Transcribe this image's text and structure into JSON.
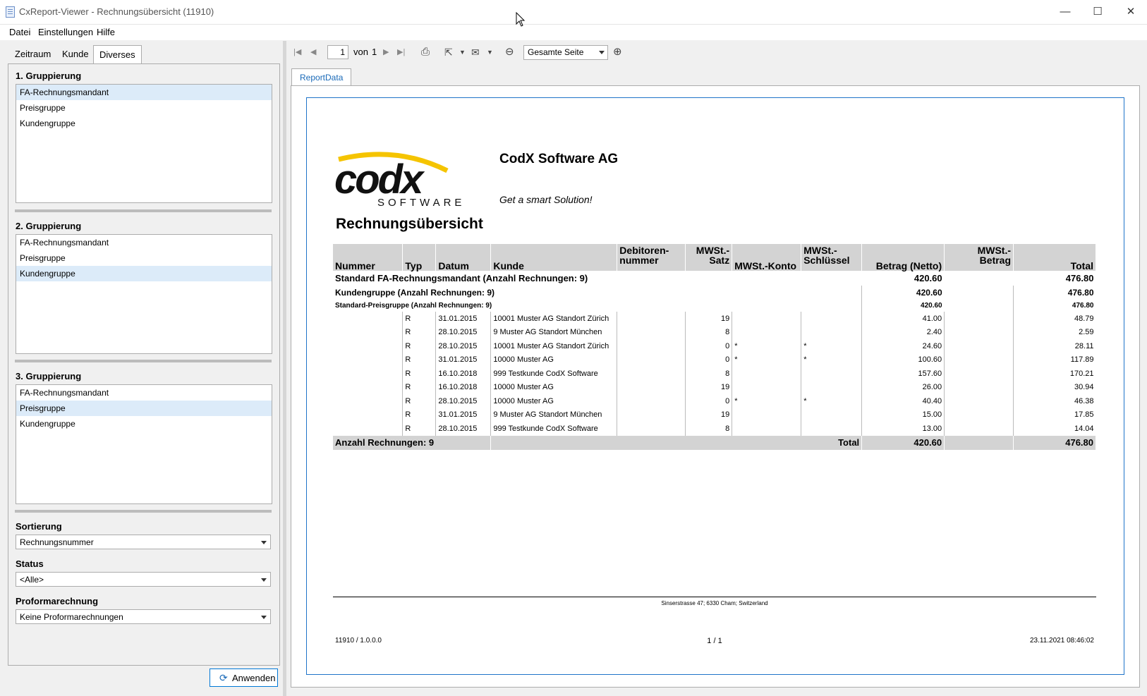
{
  "window": {
    "title": "CxReport-Viewer - Rechnungsübersicht (11910)",
    "minimize": "—",
    "maximize": "☐",
    "close": "✕"
  },
  "menu": {
    "datei": "Datei",
    "einstellungen": "Einstellungen",
    "hilfe": "Hilfe"
  },
  "tabs": {
    "zeitraum": "Zeitraum",
    "kunde": "Kunde",
    "diverses": "Diverses"
  },
  "groupings": [
    {
      "title": "1. Gruppierung",
      "items": [
        "FA-Rechnungsmandant",
        "Preisgruppe",
        "Kundengruppe"
      ],
      "selected": 0
    },
    {
      "title": "2. Gruppierung",
      "items": [
        "FA-Rechnungsmandant",
        "Preisgruppe",
        "Kundengruppe"
      ],
      "selected": 2
    },
    {
      "title": "3. Gruppierung",
      "items": [
        "FA-Rechnungsmandant",
        "Preisgruppe",
        "Kundengruppe"
      ],
      "selected": 1
    }
  ],
  "sort": {
    "label": "Sortierung",
    "value": "Rechnungsnummer"
  },
  "status": {
    "label": "Status",
    "value": "<Alle>"
  },
  "proforma": {
    "label": "Proformarechnung",
    "value": "Keine Proformarechnungen"
  },
  "apply_button": "Anwenden",
  "toolbar": {
    "page": "1",
    "of": "von",
    "total_pages": "1",
    "zoom": "Gesamte Seite"
  },
  "report_tab": "ReportData",
  "report": {
    "company": "CodX Software AG",
    "slogan": "Get a smart Solution!",
    "logo_text": "codx",
    "logo_sub": "SOFTWARE",
    "title": "Rechnungsübersicht",
    "headers": {
      "nummer": "Nummer",
      "typ": "Typ",
      "datum": "Datum",
      "kunde": "Kunde",
      "debitor1": "Debitoren-",
      "debitor2": "nummer",
      "satz1": "MWSt.-",
      "satz2": "Satz",
      "konto": "MWSt.-Konto",
      "schl1": "MWSt.-",
      "schl2": "Schlüssel",
      "netto": "Betrag (Netto)",
      "mb1": "MWSt.-",
      "mb2": "Betrag",
      "total": "Total"
    },
    "group1": {
      "label": "Standard FA-Rechnungsmandant (Anzahl Rechnungen: 9)",
      "netto": "420.60",
      "total": "476.80"
    },
    "group2": {
      "label": "Kundengruppe (Anzahl Rechnungen: 9)",
      "netto": "420.60",
      "total": "476.80"
    },
    "group3": {
      "label": "Standard-Preisgruppe (Anzahl Rechnungen: 9)",
      "netto": "420.60",
      "total": "476.80"
    },
    "rows": [
      {
        "typ": "R",
        "datum": "31.01.2015",
        "kunde": "10001 Muster AG Standort Zürich",
        "satz": "19",
        "konto": "",
        "schl": "",
        "netto": "41.00",
        "total": "48.79"
      },
      {
        "typ": "R",
        "datum": "28.10.2015",
        "kunde": "9 Muster AG Standort München",
        "satz": "8",
        "konto": "",
        "schl": "",
        "netto": "2.40",
        "total": "2.59"
      },
      {
        "typ": "R",
        "datum": "28.10.2015",
        "kunde": "10001 Muster AG Standort Zürich",
        "satz": "0",
        "konto": "*",
        "schl": "*",
        "netto": "24.60",
        "total": "28.11"
      },
      {
        "typ": "R",
        "datum": "31.01.2015",
        "kunde": "10000 Muster AG",
        "satz": "0",
        "konto": "*",
        "schl": "*",
        "netto": "100.60",
        "total": "117.89"
      },
      {
        "typ": "R",
        "datum": "16.10.2018",
        "kunde": "999 Testkunde CodX Software",
        "satz": "8",
        "konto": "",
        "schl": "",
        "netto": "157.60",
        "total": "170.21"
      },
      {
        "typ": "R",
        "datum": "16.10.2018",
        "kunde": "10000 Muster AG",
        "satz": "19",
        "konto": "",
        "schl": "",
        "netto": "26.00",
        "total": "30.94"
      },
      {
        "typ": "R",
        "datum": "28.10.2015",
        "kunde": "10000 Muster AG",
        "satz": "0",
        "konto": "*",
        "schl": "*",
        "netto": "40.40",
        "total": "46.38"
      },
      {
        "typ": "R",
        "datum": "31.01.2015",
        "kunde": "9 Muster AG Standort München",
        "satz": "19",
        "konto": "",
        "schl": "",
        "netto": "15.00",
        "total": "17.85"
      },
      {
        "typ": "R",
        "datum": "28.10.2015",
        "kunde": "999 Testkunde CodX Software",
        "satz": "8",
        "konto": "",
        "schl": "",
        "netto": "13.00",
        "total": "14.04"
      }
    ],
    "footer_row": {
      "count": "Anzahl Rechnungen: 9",
      "label": "Total",
      "netto": "420.60",
      "total": "476.80"
    },
    "address": "Sinserstrasse 47; 6330 Cham; Switzerland",
    "version": "11910 / 1.0.0.0",
    "pageinfo": "1 / 1",
    "printed": "23.11.2021 08:46:02"
  }
}
